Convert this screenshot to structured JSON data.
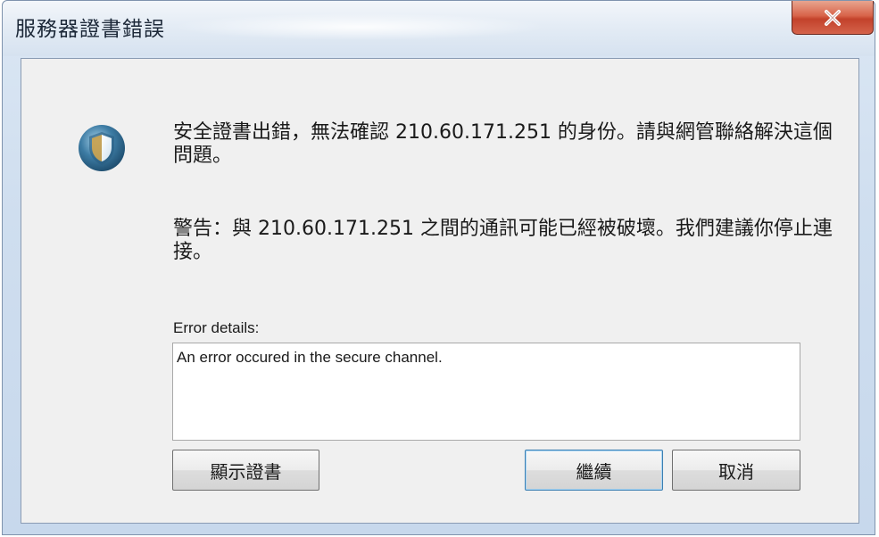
{
  "window": {
    "title": "服務器證書錯誤"
  },
  "icons": {
    "close": "close-icon",
    "shield": "shield-icon"
  },
  "message": {
    "error_text": "安全證書出錯，無法確認 210.60.171.251 的身份。請與網管聯絡解決這個問題。",
    "warning_text": "警告：與 210.60.171.251 之間的通訊可能已經被破壞。我們建議你停止連接。"
  },
  "details": {
    "label": "Error details:",
    "value": "An error occured in the secure channel."
  },
  "buttons": {
    "show_certificate": "顯示證書",
    "continue": "繼續",
    "cancel": "取消"
  },
  "colors": {
    "close_button": "#c7452e",
    "shield_outer": "#3d7ca4",
    "shield_inner": "#ffffff"
  }
}
